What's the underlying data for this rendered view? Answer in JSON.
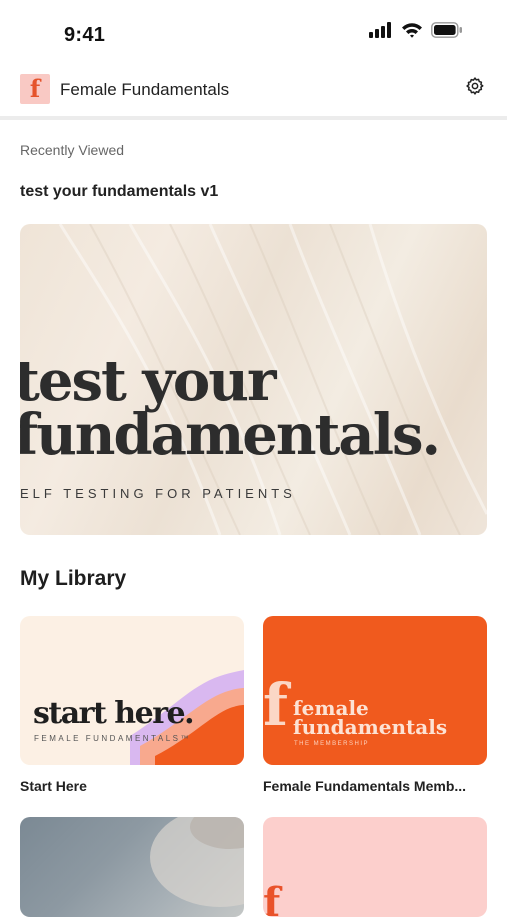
{
  "status_bar": {
    "time": "9:41",
    "icons": [
      "cellular-signal-icon",
      "wifi-icon",
      "battery-icon"
    ]
  },
  "header": {
    "logo_letter": "f",
    "title": "Female Fundamentals",
    "settings_icon": "gear-icon"
  },
  "recently_viewed": {
    "section_label": "Recently Viewed",
    "item_title": "test your fundamentals v1",
    "hero": {
      "line1": "test your",
      "line2": "fundamentals.",
      "subtitle": "ELF TESTING FOR PATIENTS"
    }
  },
  "library": {
    "heading": "My Library",
    "cards": [
      {
        "caption": "Start Here",
        "art_title": "start here.",
        "art_subtitle": "FEMALE FUNDAMENTALS™"
      },
      {
        "caption": "Female Fundamentals Memb...",
        "art_letter": "f",
        "art_title_1": "female",
        "art_title_2": "fundamentals",
        "art_subtitle": "THE MEMBERSHIP"
      },
      {
        "caption": ""
      },
      {
        "art_letter": "f"
      }
    ]
  },
  "colors": {
    "brand_orange": "#f05a1e",
    "brand_pink": "#f9c9c4",
    "cream": "#fcf0e4"
  }
}
